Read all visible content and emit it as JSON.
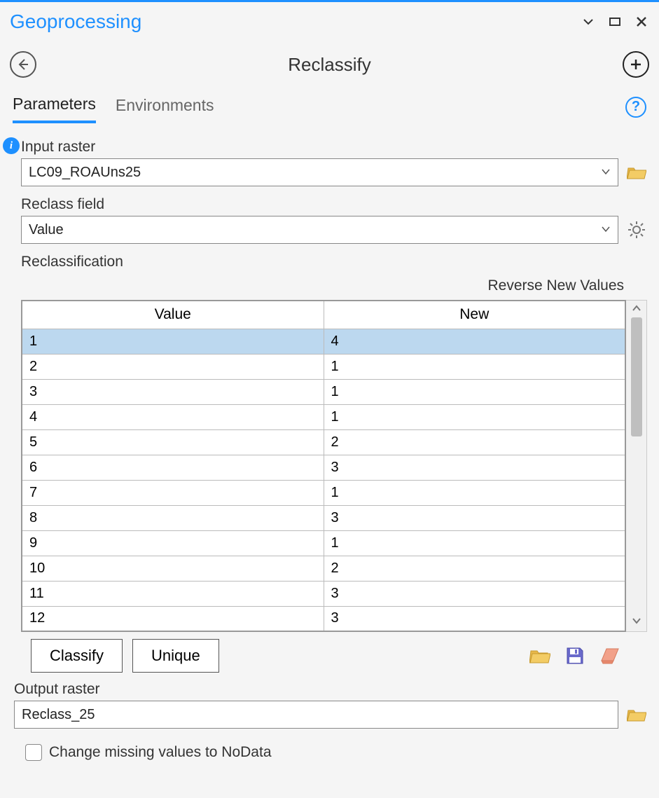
{
  "pane": {
    "title": "Geoprocessing"
  },
  "tool": {
    "title": "Reclassify"
  },
  "tabs": {
    "parameters": "Parameters",
    "environments": "Environments"
  },
  "inputRaster": {
    "label": "Input raster",
    "value": "LC09_ROAUns25"
  },
  "reclassField": {
    "label": "Reclass field",
    "value": "Value"
  },
  "reclass": {
    "label": "Reclassification",
    "reverseLabel": "Reverse New Values",
    "headers": {
      "value": "Value",
      "new": "New"
    },
    "rows": [
      {
        "value": "1",
        "new": "4"
      },
      {
        "value": "2",
        "new": "1"
      },
      {
        "value": "3",
        "new": "1"
      },
      {
        "value": "4",
        "new": "1"
      },
      {
        "value": "5",
        "new": "2"
      },
      {
        "value": "6",
        "new": "3"
      },
      {
        "value": "7",
        "new": "1"
      },
      {
        "value": "8",
        "new": "3"
      },
      {
        "value": "9",
        "new": "1"
      },
      {
        "value": "10",
        "new": "2"
      },
      {
        "value": "11",
        "new": "3"
      },
      {
        "value": "12",
        "new": "3"
      }
    ],
    "classifyBtn": "Classify",
    "uniqueBtn": "Unique"
  },
  "outputRaster": {
    "label": "Output raster",
    "value": "Reclass_25"
  },
  "changeMissing": {
    "label": "Change missing values to NoData",
    "checked": false
  }
}
